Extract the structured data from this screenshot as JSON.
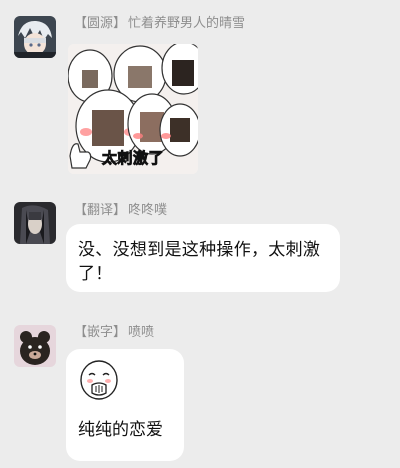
{
  "messages": [
    {
      "tag": "【圆源】",
      "name": "忙着养野男人的晴雪",
      "image_caption": "太刺激了"
    },
    {
      "tag": "【翻译】",
      "name": "咚咚噗",
      "text": "没、没想到是这种操作，太刺激了！"
    },
    {
      "tag": "【嵌字】",
      "name": "喷喷",
      "caption": "纯纯的恋爱"
    }
  ],
  "colors": {
    "background": "#ececec",
    "bubble": "#ffffff",
    "sender_text": "#8e8e8e",
    "body_text": "#111111",
    "blush": "#ff6b6b"
  }
}
